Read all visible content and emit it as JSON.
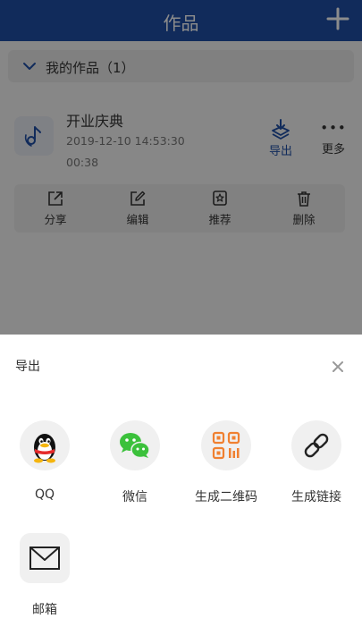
{
  "header": {
    "title": "作品"
  },
  "section": {
    "title": "我的作品（1）"
  },
  "work": {
    "title": "开业庆典",
    "date": "2019-12-10 14:53:30",
    "duration": "00:38",
    "export_label": "导出",
    "more_label": "更多"
  },
  "actions": [
    {
      "label": "分享",
      "icon": "share-icon"
    },
    {
      "label": "编辑",
      "icon": "edit-icon"
    },
    {
      "label": "推荐",
      "icon": "recommend-icon"
    },
    {
      "label": "删除",
      "icon": "trash-icon"
    }
  ],
  "sheet": {
    "title": "导出",
    "options": [
      {
        "label": "QQ",
        "icon": "qq-icon"
      },
      {
        "label": "微信",
        "icon": "wechat-icon"
      },
      {
        "label": "生成二维码",
        "icon": "qrcode-icon"
      },
      {
        "label": "生成链接",
        "icon": "link-icon"
      },
      {
        "label": "邮箱",
        "icon": "mail-icon"
      }
    ]
  },
  "colors": {
    "primary": "#1f4fa6",
    "qr_orange": "#f08030",
    "wechat_green": "#3bc13b"
  }
}
